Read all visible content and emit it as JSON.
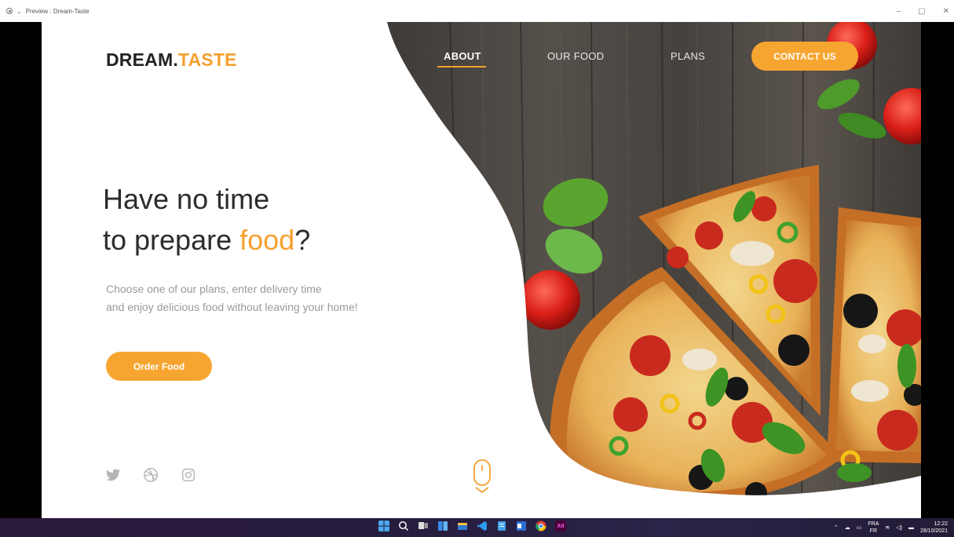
{
  "window": {
    "title": "Preview : Dream-Taste",
    "controls": [
      "–",
      "▢",
      "✕"
    ]
  },
  "brand": {
    "name_main": "DREAM.",
    "name_accent": "TASTE",
    "accent_color": "#f5a02f"
  },
  "nav": {
    "items": [
      {
        "label": "ABOUT",
        "active": true
      },
      {
        "label": "OUR FOOD",
        "active": false
      },
      {
        "label": "PLANS",
        "active": false
      }
    ],
    "contact_label": "CONTACT US"
  },
  "hero": {
    "line1": "Have no time",
    "line2_prefix": "to prepare ",
    "line2_accent": "food",
    "line2_suffix": "?",
    "sub_line1": "Choose one of our plans, enter delivery time",
    "sub_line2": "and enjoy delicious food without leaving your home!",
    "cta_label": "Order Food"
  },
  "social": [
    "twitter-icon",
    "dribbble-icon",
    "instagram-icon"
  ],
  "taskbar": {
    "apps": [
      "windows-start-icon",
      "search-icon",
      "task-view-icon",
      "widgets-icon",
      "file-explorer-icon",
      "vscode-icon",
      "notepad-icon",
      "word-icon",
      "chrome-icon",
      "xd-icon"
    ],
    "xd_label": "Xd",
    "lang_top": "FRA",
    "lang_bottom": "FR",
    "time": "12:22",
    "date": "28/10/2021"
  }
}
